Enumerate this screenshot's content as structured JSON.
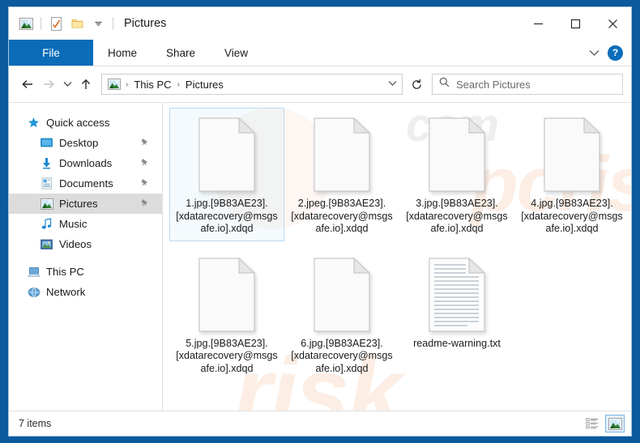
{
  "window": {
    "title": "Pictures",
    "quick_access_toolbar": [
      {
        "name": "pictures-folder-icon",
        "label": "Pictures"
      },
      {
        "name": "properties-icon",
        "label": "Properties"
      },
      {
        "name": "new-folder-icon",
        "label": "New folder"
      },
      {
        "name": "customize-dropdown-icon",
        "label": "Customize Quick Access Toolbar"
      }
    ],
    "controls": {
      "minimize": "─",
      "maximize": "☐",
      "close": "✕"
    }
  },
  "ribbon": {
    "tabs": [
      {
        "label": "File",
        "active": true
      },
      {
        "label": "Home",
        "active": false
      },
      {
        "label": "Share",
        "active": false
      },
      {
        "label": "View",
        "active": false
      }
    ],
    "expand_label": "⌄",
    "help_label": "?"
  },
  "address_bar": {
    "back_label": "←",
    "forward_label": "→",
    "recent_label": "⌄",
    "up_label": "↑",
    "refresh_label": "↻",
    "dropdown_label": "⌄",
    "breadcrumb": [
      "This PC",
      "Pictures"
    ],
    "separator": "›"
  },
  "search": {
    "placeholder": "Search Pictures",
    "icon": "search-icon"
  },
  "sidebar": {
    "items": [
      {
        "label": "Quick access",
        "icon": "star-icon",
        "indent": false,
        "pinned": false,
        "selected": false
      },
      {
        "label": "Desktop",
        "icon": "desktop-icon",
        "indent": true,
        "pinned": true,
        "selected": false
      },
      {
        "label": "Downloads",
        "icon": "download-icon",
        "indent": true,
        "pinned": true,
        "selected": false
      },
      {
        "label": "Documents",
        "icon": "documents-icon",
        "indent": true,
        "pinned": true,
        "selected": false
      },
      {
        "label": "Pictures",
        "icon": "pictures-icon",
        "indent": true,
        "pinned": true,
        "selected": true
      },
      {
        "label": "Music",
        "icon": "music-icon",
        "indent": true,
        "pinned": false,
        "selected": false
      },
      {
        "label": "Videos",
        "icon": "videos-icon",
        "indent": true,
        "pinned": false,
        "selected": false
      },
      {
        "label": "This PC",
        "icon": "computer-icon",
        "indent": false,
        "pinned": false,
        "selected": false
      },
      {
        "label": "Network",
        "icon": "network-icon",
        "indent": false,
        "pinned": false,
        "selected": false
      }
    ],
    "pin_glyph": "📌"
  },
  "files": [
    {
      "name": "1.jpg.[9B83AE23].[xdatarecovery@msgsafe.io].xdqd",
      "icon": "blank-file-icon",
      "selected": true
    },
    {
      "name": "2.jpeg.[9B83AE23].[xdatarecovery@msgsafe.io].xdqd",
      "icon": "blank-file-icon",
      "selected": false
    },
    {
      "name": "3.jpg.[9B83AE23].[xdatarecovery@msgsafe.io].xdqd",
      "icon": "blank-file-icon",
      "selected": false
    },
    {
      "name": "4.jpg.[9B83AE23].[xdatarecovery@msgsafe.io].xdqd",
      "icon": "blank-file-icon",
      "selected": false
    },
    {
      "name": "5.jpg.[9B83AE23].[xdatarecovery@msgsafe.io].xdqd",
      "icon": "blank-file-icon",
      "selected": false
    },
    {
      "name": "6.jpg.[9B83AE23].[xdatarecovery@msgsafe.io].xdqd",
      "icon": "blank-file-icon",
      "selected": false
    },
    {
      "name": "readme-warning.txt",
      "icon": "text-file-icon",
      "selected": false
    }
  ],
  "status_bar": {
    "item_count": "7 items",
    "views": [
      {
        "name": "details-view-button",
        "active": false
      },
      {
        "name": "large-icons-view-button",
        "active": true
      }
    ]
  },
  "watermark": {
    "line1": "risk",
    "line2": "pcrisk",
    "line3": "com"
  },
  "colors": {
    "frame": "#0b5a9e",
    "accent": "#0b6cb8",
    "selection": "#dcdcdc",
    "tile_selection_border": "#bcd9f0"
  }
}
